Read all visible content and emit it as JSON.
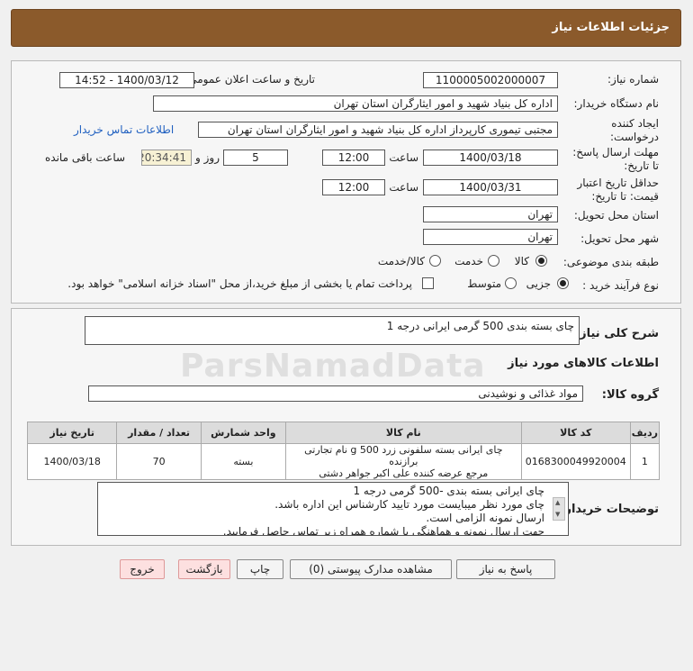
{
  "header": {
    "title": "جزئیات اطلاعات نیاز"
  },
  "form": {
    "need_number_label": "شماره نیاز:",
    "need_number": "1100005002000007",
    "announce_label": "تاریخ و ساعت اعلان عمومی:",
    "announce_value": "1400/03/12 - 14:52",
    "buyer_org_label": "نام دستگاه خریدار:",
    "buyer_org": "اداره کل بنیاد شهید و امور ایثارگران استان تهران",
    "creator_label_1": "ایجاد کننده",
    "creator_label_2": "درخواست:",
    "creator": "مجتبی  تیموری کارپرداز اداره کل بنیاد شهید و امور ایثارگران استان تهران",
    "contact_link": "اطلاعات تماس خریدار",
    "deadline_label_1": "مهلت ارسال پاسخ:",
    "deadline_label_2": "تا تاریخ:",
    "deadline_date": "1400/03/18",
    "time_label": "ساعت",
    "deadline_time": "12:00",
    "days_value": "5",
    "days_label": "روز و",
    "remaining_time": "20:34:41",
    "remaining_label": "ساعت باقی مانده",
    "validity_label_1": "حداقل تاریخ اعتبار",
    "validity_label_2": "قیمت: تا تاریخ:",
    "validity_date": "1400/03/31",
    "validity_time": "12:00",
    "province_label": "استان محل تحویل:",
    "province": "تهران",
    "city_label": "شهر محل تحویل:",
    "city": "تهران",
    "category_label": "طبقه بندی موضوعی:",
    "category_options": [
      "کالا",
      "خدمت",
      "کالا/خدمت"
    ],
    "process_label": "نوع فرآیند خرید :",
    "process_options": [
      "جزیی",
      "متوسط"
    ],
    "payment_note": "پرداخت تمام یا بخشی از مبلغ خرید،از محل \"اسناد خزانه اسلامی\" خواهد بود."
  },
  "summary": {
    "label": "شرح کلی نیاز:",
    "value": "چای بسته بندی 500 گرمی ایرانی درجه 1"
  },
  "goods": {
    "section_title": "اطلاعات کالاهای مورد نیاز",
    "group_label": "گروه کالا:",
    "group_value": "مواد غذائی و نوشیدنی",
    "columns": [
      "ردیف",
      "کد کالا",
      "نام کالا",
      "واحد شمارش",
      "تعداد / مقدار",
      "تاریخ نیاز"
    ],
    "rows": [
      {
        "index": "1",
        "code": "0168300049920004",
        "name_1": "چای ایرانی بسته سلفونی زرد 500 g نام تجارتی برازنده",
        "name_2": "مرجع عرضه کننده علی اکبر جواهر دشتی",
        "unit": "بسته",
        "qty": "70",
        "date": "1400/03/18"
      }
    ]
  },
  "buyer_desc": {
    "label": "توضیحات خریدار:",
    "lines": [
      "چای ایرانی بسته بندی -500 گرمی درجه 1",
      "چای مورد نظر میبایست مورد تایید کارشناس  این اداره باشد.",
      "ارسال نمونه الزامی است.",
      "جهت ارسال نمونه و هماهنگی با شماره همراه زیر تماس حاصل فرمایید."
    ]
  },
  "buttons": {
    "reply": "پاسخ به نیاز",
    "attachments": "مشاهده مدارک پیوستی (0)",
    "print": "چاپ",
    "back": "بازگشت",
    "exit": "خروج"
  },
  "watermark": "ParsNamadData"
}
